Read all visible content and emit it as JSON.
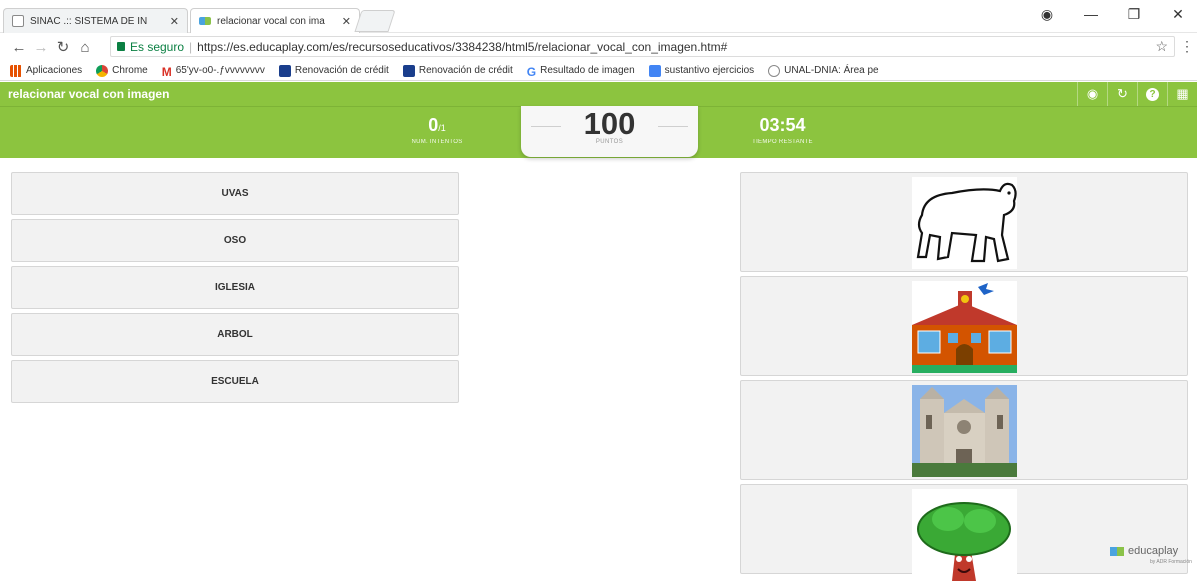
{
  "browser": {
    "tabs": [
      {
        "title": "SINAC .:: SISTEMA DE IN",
        "active": false
      },
      {
        "title": "relacionar vocal con ima",
        "active": true
      }
    ],
    "secure_label": "Es seguro",
    "url": "https://es.educaplay.com/es/recursoseducativos/3384238/html5/relacionar_vocal_con_imagen.htm#",
    "bookmarks": [
      {
        "label": "Aplicaciones",
        "icon": "apps-icon"
      },
      {
        "label": "Chrome",
        "icon": "chrome-icon"
      },
      {
        "label": "65'yv-o0-.ƒvvvvvvvv",
        "icon": "gmail-icon"
      },
      {
        "label": "Renovación de crédit",
        "icon": "renovacion-icon"
      },
      {
        "label": "Renovación de crédit",
        "icon": "renovacion-icon"
      },
      {
        "label": "Resultado de imagen",
        "icon": "google-icon"
      },
      {
        "label": "sustantivo ejercicios",
        "icon": "docs-icon"
      },
      {
        "label": "UNAL-DNIA: Área pe",
        "icon": "unal-icon"
      }
    ]
  },
  "app": {
    "title": "relacionar vocal con imagen",
    "header_icons": [
      "gamepad-icon",
      "refresh-icon",
      "help-icon",
      "grid-icon"
    ]
  },
  "stats": {
    "attempts_value": "0",
    "attempts_total": "/1",
    "attempts_label": "NUM. INTENTOS",
    "points_value": "100",
    "points_label": "PUNTOS",
    "time_value": "03:54",
    "time_label": "TIEMPO RESTANTE"
  },
  "words": [
    "UVAS",
    "OSO",
    "IGLESIA",
    "ARBOL",
    "ESCUELA"
  ],
  "images": [
    "polar-bear-image",
    "school-building-image",
    "church-image",
    "tree-image"
  ],
  "colors": {
    "accent_green": "#8cc43f"
  },
  "branding": {
    "logo_text": "educaplay",
    "logo_subtext": "by ADR Formación"
  }
}
